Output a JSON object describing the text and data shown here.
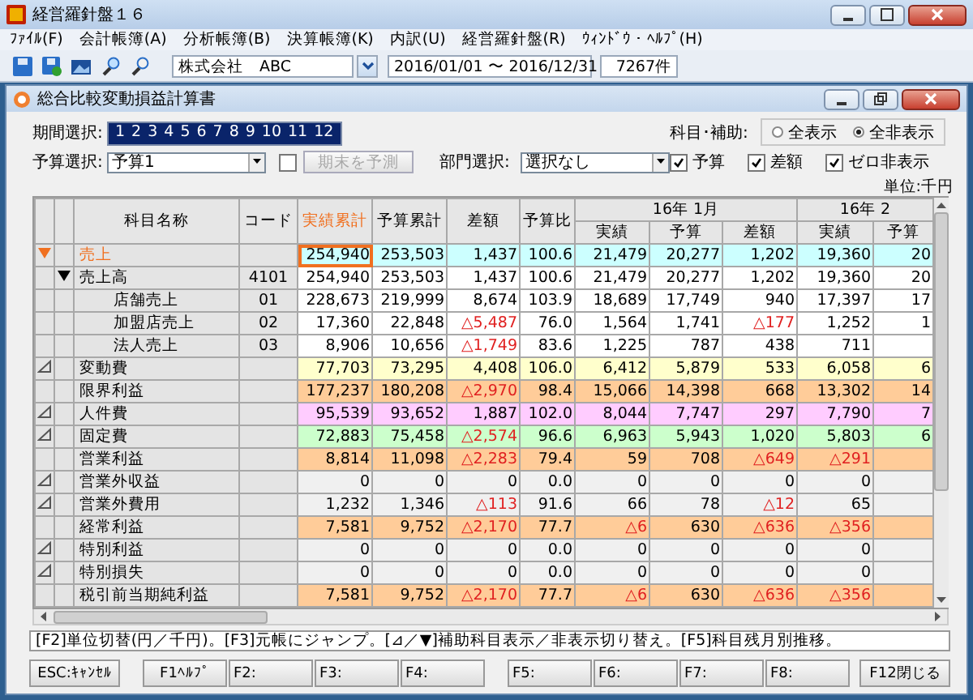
{
  "window": {
    "title": "経営羅針盤１６"
  },
  "menu": [
    "ﾌｧｲﾙ(F)",
    "会計帳簿(A)",
    "分析帳簿(B)",
    "決算帳簿(K)",
    "内訳(U)",
    "経営羅針盤(R)",
    "ｳｨﾝﾄﾞｳ・ﾍﾙﾌﾟ(H)"
  ],
  "toolbar": {
    "company": "株式会社　ABC",
    "period": "2016/01/01 〜 2016/12/31",
    "count": "7267件"
  },
  "document": {
    "title": "総合比較変動損益計算書"
  },
  "period": {
    "label": "期間選択:",
    "months": [
      {
        "label": "1",
        "selected": true
      },
      {
        "label": "2",
        "selected": true
      },
      {
        "label": "3",
        "selected": true
      },
      {
        "label": "4",
        "selected": true
      },
      {
        "label": "5",
        "selected": true
      },
      {
        "label": "6",
        "selected": true
      },
      {
        "label": "7",
        "selected": true
      },
      {
        "label": "8",
        "selected": true
      },
      {
        "label": "9",
        "selected": true
      },
      {
        "label": "10",
        "selected": true
      },
      {
        "label": "11",
        "selected": true
      },
      {
        "label": "12",
        "selected": true
      }
    ]
  },
  "budget": {
    "label": "予算選択:",
    "value": "予算1",
    "forecast_checked": false,
    "forecast_button": "期末を予測",
    "forecast_disabled": true
  },
  "department": {
    "label": "部門選択:",
    "value": "選択なし"
  },
  "subaccount": {
    "label": "科目･補助:",
    "options": [
      {
        "label": "全表示",
        "selected": false
      },
      {
        "label": "全非表示",
        "selected": true
      }
    ]
  },
  "show": [
    {
      "label": "予算",
      "checked": true
    },
    {
      "label": "差額",
      "checked": true
    },
    {
      "label": "ゼロ非表示",
      "checked": true
    }
  ],
  "unit": "単位:千円",
  "table": {
    "name_header": "科目名称",
    "code_header": "コード",
    "totals": [
      {
        "label": "実績累計",
        "selected": true
      },
      {
        "label": "予算累計",
        "selected": false
      },
      {
        "label": "差額",
        "selected": false
      },
      {
        "label": "予算比",
        "selected": false
      }
    ],
    "months": [
      {
        "label": "16年 1月",
        "sub": [
          "実績",
          "予算",
          "差額"
        ]
      },
      {
        "label": "16年 2",
        "sub": [
          "実績",
          "予算"
        ]
      }
    ],
    "rows": [
      {
        "name": "売上",
        "kind": "group",
        "expanded": true,
        "selected": true,
        "color": "#ccffff",
        "values": [
          "254,940",
          "253,503",
          "1,437",
          "100.6",
          "21,479",
          "20,277",
          "1,202",
          "19,360",
          "20"
        ],
        "children": [
          {
            "name": "売上高",
            "code": "4101",
            "kind": "group",
            "expanded": true,
            "selected": false,
            "color": "#ffffff",
            "values": [
              "254,940",
              "253,503",
              "1,437",
              "100.6",
              "21,479",
              "20,277",
              "1,202",
              "19,360",
              "20"
            ],
            "children": [
              {
                "name": "店舗売上",
                "code": "01",
                "kind": "line",
                "selected": false,
                "color": "#ffffff",
                "values": [
                  "228,673",
                  "219,999",
                  "8,674",
                  "103.9",
                  "18,689",
                  "17,749",
                  "940",
                  "17,397",
                  "17"
                ]
              },
              {
                "name": "加盟店売上",
                "code": "02",
                "kind": "line",
                "selected": false,
                "color": "#ffffff",
                "negative": [
                  false,
                  false,
                  true,
                  false,
                  false,
                  false,
                  true,
                  false,
                  false
                ],
                "values": [
                  "17,360",
                  "22,848",
                  "△5,487",
                  "76.0",
                  "1,564",
                  "1,741",
                  "△177",
                  "1,252",
                  "1"
                ]
              },
              {
                "name": "法人売上",
                "code": "03",
                "kind": "line",
                "selected": false,
                "color": "#ffffff",
                "negative": [
                  false,
                  false,
                  true,
                  false,
                  false,
                  false,
                  false,
                  false
                ],
                "values": [
                  "8,906",
                  "10,656",
                  "△1,749",
                  "83.6",
                  "1,225",
                  "787",
                  "438",
                  "711"
                ]
              }
            ]
          }
        ]
      },
      {
        "name": "変動費",
        "kind": "group",
        "expanded": false,
        "selected": false,
        "color": "#ffffcc",
        "values": [
          "77,703",
          "73,295",
          "4,408",
          "106.0",
          "6,412",
          "5,879",
          "533",
          "6,058",
          "6"
        ]
      },
      {
        "name": "限界利益",
        "kind": "line",
        "selected": false,
        "color": "#ffcc99",
        "negative": [
          false,
          false,
          true,
          false,
          false,
          false,
          false,
          false,
          false
        ],
        "values": [
          "177,237",
          "180,208",
          "△2,970",
          "98.4",
          "15,066",
          "14,398",
          "668",
          "13,302",
          "14"
        ]
      },
      {
        "name": "人件費",
        "kind": "group",
        "expanded": false,
        "selected": false,
        "color": "#ffccff",
        "values": [
          "95,539",
          "93,652",
          "1,887",
          "102.0",
          "8,044",
          "7,747",
          "297",
          "7,790",
          "7"
        ]
      },
      {
        "name": "固定費",
        "kind": "group",
        "expanded": false,
        "selected": false,
        "color": "#ccffcc",
        "negative": [
          false,
          false,
          true,
          false,
          false,
          false,
          false,
          false,
          false
        ],
        "values": [
          "72,883",
          "75,458",
          "△2,574",
          "96.6",
          "6,963",
          "5,943",
          "1,020",
          "5,803",
          "6"
        ]
      },
      {
        "name": "営業利益",
        "kind": "line",
        "selected": false,
        "color": "#ffcc99",
        "negative": [
          false,
          false,
          true,
          false,
          false,
          false,
          true,
          true
        ],
        "values": [
          "8,814",
          "11,098",
          "△2,283",
          "79.4",
          "59",
          "708",
          "△649",
          "△291"
        ]
      },
      {
        "name": "営業外収益",
        "kind": "group",
        "expanded": false,
        "selected": false,
        "color": "#f0f0f0",
        "values": [
          "0",
          "0",
          "0",
          "0.0",
          "0",
          "0",
          "0",
          "0"
        ]
      },
      {
        "name": "営業外費用",
        "kind": "group",
        "expanded": false,
        "selected": false,
        "color": "#f0f0f0",
        "negative": [
          false,
          false,
          true,
          false,
          false,
          false,
          true,
          false
        ],
        "values": [
          "1,232",
          "1,346",
          "△113",
          "91.6",
          "66",
          "78",
          "△12",
          "65"
        ]
      },
      {
        "name": "経常利益",
        "kind": "line",
        "selected": false,
        "color": "#ffcc99",
        "negative": [
          false,
          false,
          true,
          false,
          true,
          false,
          true,
          true
        ],
        "values": [
          "7,581",
          "9,752",
          "△2,170",
          "77.7",
          "△6",
          "630",
          "△636",
          "△356"
        ]
      },
      {
        "name": "特別利益",
        "kind": "group",
        "expanded": false,
        "selected": false,
        "color": "#f0f0f0",
        "values": [
          "0",
          "0",
          "0",
          "0.0",
          "0",
          "0",
          "0",
          "0"
        ]
      },
      {
        "name": "特別損失",
        "kind": "group",
        "expanded": false,
        "selected": false,
        "color": "#f0f0f0",
        "values": [
          "0",
          "0",
          "0",
          "0.0",
          "0",
          "0",
          "0",
          "0"
        ]
      },
      {
        "name": "税引前当期純利益",
        "kind": "line",
        "selected": false,
        "color": "#ffcc99",
        "negative": [
          false,
          false,
          true,
          false,
          true,
          false,
          true,
          true
        ],
        "values": [
          "7,581",
          "9,752",
          "△2,170",
          "77.7",
          "△6",
          "630",
          "△636",
          "△356"
        ]
      }
    ]
  },
  "help": "[F2]単位切替(円／千円)。[F3]元帳にジャンプ。[⊿／▼]補助科目表示／非表示切り替え。[F5]科目残月別推移。",
  "keys": [
    [
      "ESC:ｷｬﾝｾﾙ",
      "F1ﾍﾙﾌﾟ",
      "F2:",
      "F3:",
      "F4:"
    ],
    [
      "F5:",
      "F6:",
      "F7:",
      "F8:"
    ],
    [
      "F12閉じる"
    ]
  ]
}
